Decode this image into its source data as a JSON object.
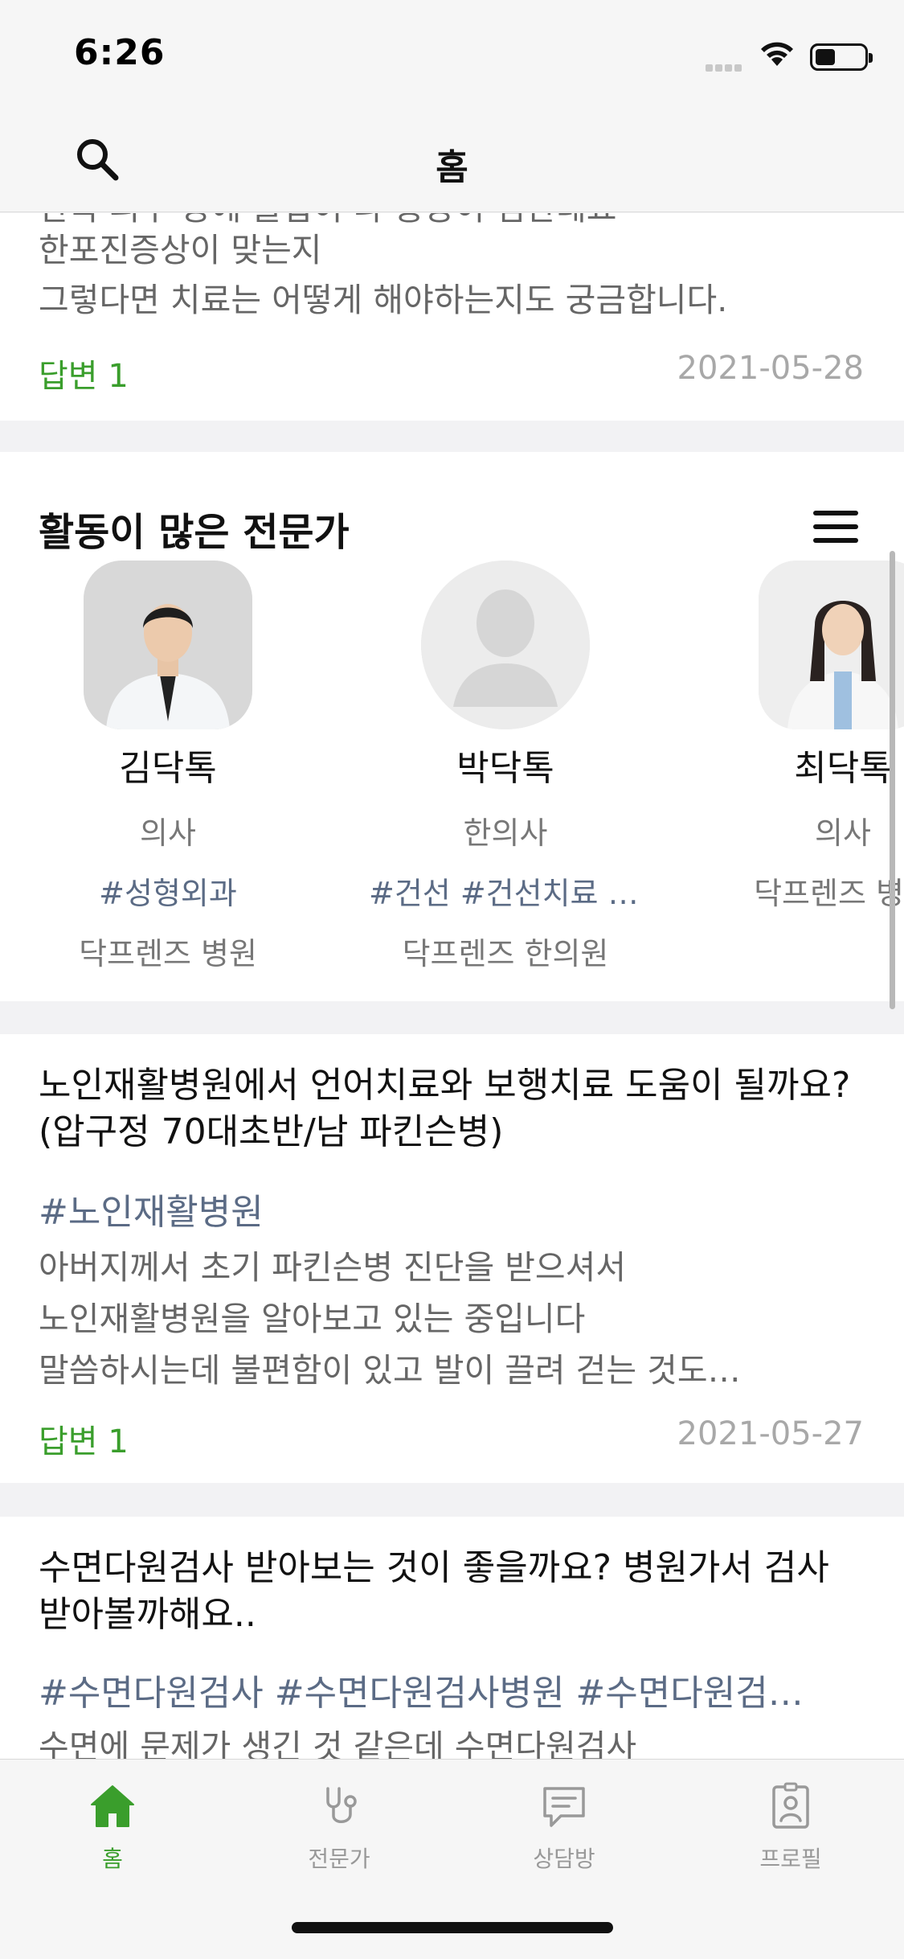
{
  "status": {
    "time": "6:26"
  },
  "nav": {
    "title": "홈"
  },
  "top_card": {
    "line_partial": "한쪽 피부 등에 물집이 나 통증이 심한데요",
    "line1": "한포진증상이 맞는지",
    "line2": "그렇다면 치료는 어떻게 해야하는지도 궁금합니다.",
    "answer": "답변 1",
    "date": "2021-05-28"
  },
  "experts": {
    "title": "활동이 많은 전문가",
    "items": [
      {
        "name": "김닥톡",
        "role": "의사",
        "tag": "#성형외과",
        "hospital": "닥프렌즈 병원"
      },
      {
        "name": "박닥톡",
        "role": "한의사",
        "tag": "#건선 #건선치료 #…",
        "hospital": "닥프렌즈 한의원"
      },
      {
        "name": "최닥톡",
        "role": "의사",
        "tag": "",
        "hospital": "닥프렌즈 병원"
      }
    ]
  },
  "question1": {
    "title": "노인재활병원에서 언어치료와 보행치료 도움이 될까요? (압구정 70대초반/남 파킨슨병)",
    "tags": "#노인재활병원",
    "line1": "아버지께서 초기 파킨슨병 진단을 받으셔서",
    "line2": "노인재활병원을 알아보고 있는 중입니다",
    "line3": "말씀하시는데 불편함이 있고 발이 끌려 걷는 것도…",
    "answer": "답변 1",
    "date": "2021-05-27"
  },
  "question2": {
    "title": "수면다원검사 받아보는 것이 좋을까요? 병원가서 검사 받아볼까해요..",
    "tags": "#수면다원검사 #수면다원검사병원 #수면다원검…",
    "line1": "수면에 문제가 생긴 것 같은데 수면다원검사"
  },
  "tabs": [
    {
      "label": "홈",
      "icon": "home-icon",
      "active": true
    },
    {
      "label": "전문가",
      "icon": "stethoscope-icon",
      "active": false
    },
    {
      "label": "상담방",
      "icon": "chat-icon",
      "active": false
    },
    {
      "label": "프로필",
      "icon": "id-badge-icon",
      "active": false
    }
  ],
  "colors": {
    "accent": "#3a9e2c",
    "tag": "#5b6b85",
    "muted": "#666666"
  }
}
